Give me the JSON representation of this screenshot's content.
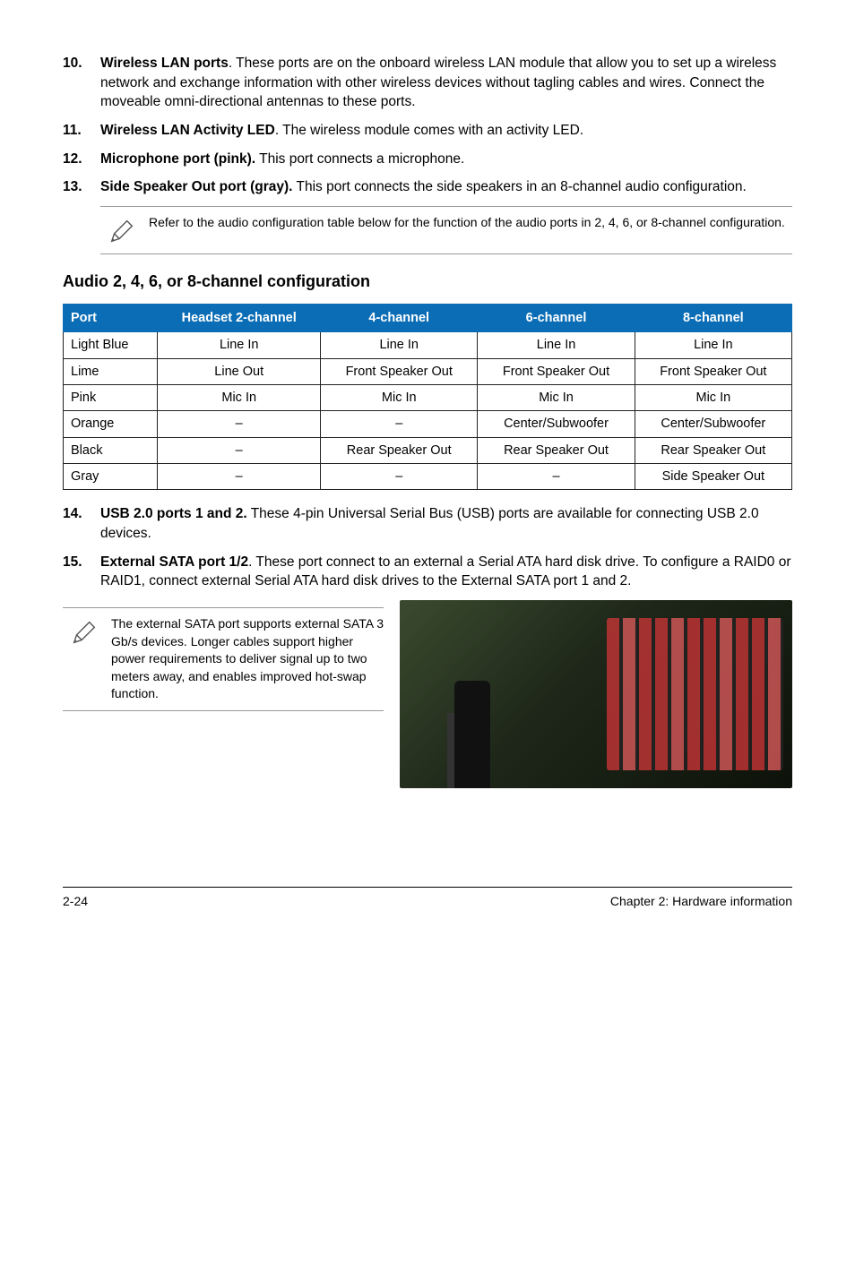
{
  "items": [
    {
      "num": "10.",
      "title": "Wireless LAN ports",
      "text": ". These ports are on the onboard wireless LAN module that allow you to set up a wireless network and exchange information with other wireless devices without tagling cables and wires. Connect the moveable omni-directional antennas to these ports."
    },
    {
      "num": "11.",
      "title": "Wireless LAN Activity LED",
      "text": ". The wireless module comes with an activity LED."
    },
    {
      "num": "12.",
      "title": "Microphone port (pink).",
      "text": " This port connects a microphone."
    },
    {
      "num": "13.",
      "title": "Side Speaker Out port (gray).",
      "text": " This port connects the side speakers in an 8-channel audio configuration."
    }
  ],
  "note1": "Refer to the audio configuration table below for the function of the audio ports in 2, 4, 6, or 8-channel configuration.",
  "section_heading": "Audio 2, 4, 6, or 8-channel configuration",
  "table": {
    "headers": [
      "Port",
      "Headset 2-channel",
      "4-channel",
      "6-channel",
      "8-channel"
    ],
    "rows": [
      [
        "Light Blue",
        "Line In",
        "Line In",
        "Line In",
        "Line In"
      ],
      [
        "Lime",
        "Line Out",
        "Front Speaker Out",
        "Front Speaker Out",
        "Front Speaker Out"
      ],
      [
        "Pink",
        "Mic In",
        "Mic In",
        "Mic In",
        "Mic In"
      ],
      [
        "Orange",
        "–",
        "–",
        "Center/Subwoofer",
        "Center/Subwoofer"
      ],
      [
        "Black",
        "–",
        "Rear Speaker Out",
        "Rear Speaker Out",
        "Rear Speaker Out"
      ],
      [
        "Gray",
        "–",
        "–",
        "–",
        "Side Speaker Out"
      ]
    ]
  },
  "items2": [
    {
      "num": "14.",
      "title": "USB 2.0 ports 1 and 2.",
      "text": " These 4-pin Universal Serial Bus (USB) ports are available for connecting USB 2.0 devices."
    },
    {
      "num": "15.",
      "title": "External SATA port 1/2",
      "text": ". These port connect to an external a Serial ATA hard disk drive. To configure a RAID0 or RAID1, connect external Serial ATA hard disk drives to the External SATA port 1 and 2."
    }
  ],
  "note2": "The external SATA port supports external SATA 3 Gb/s devices. Longer cables support higher power requirements to deliver signal up to two meters away, and enables improved hot-swap function.",
  "footer": {
    "left": "2-24",
    "right": "Chapter 2: Hardware information"
  }
}
